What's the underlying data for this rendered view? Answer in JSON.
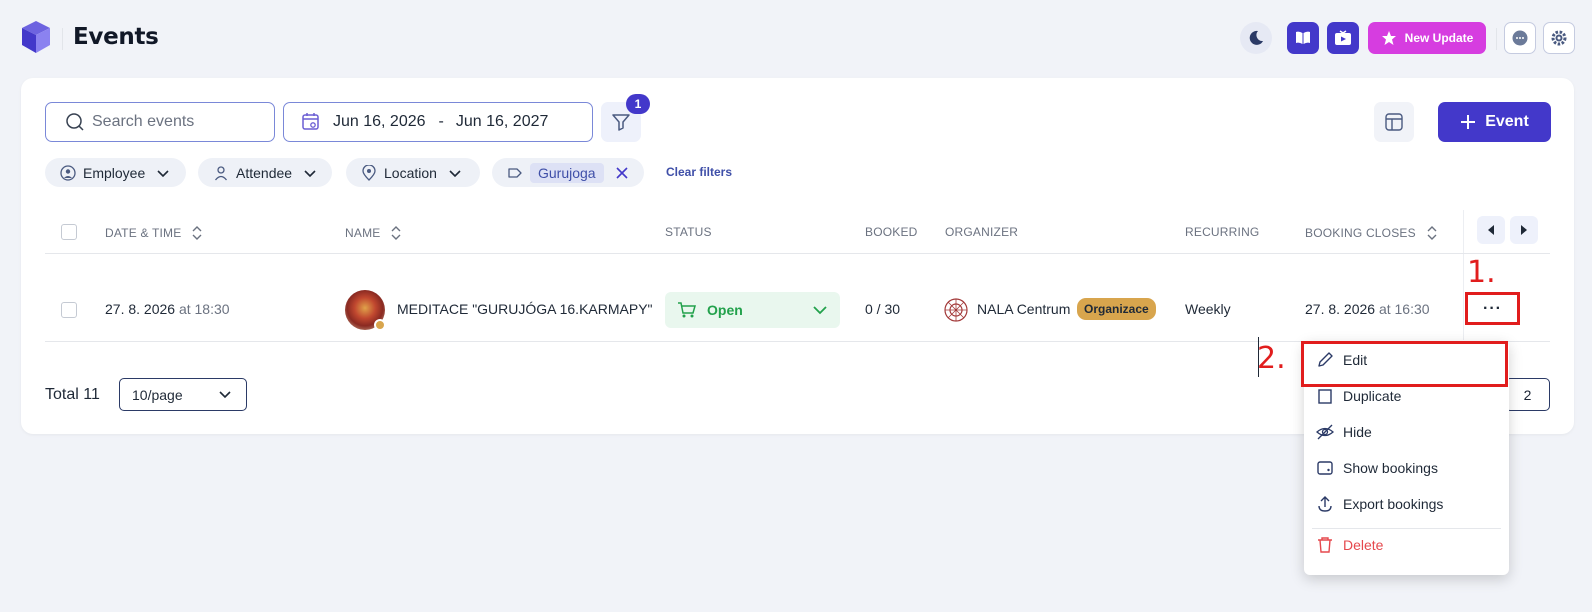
{
  "header": {
    "title": "Events",
    "new_update_label": "New Update"
  },
  "toolbar": {
    "search_placeholder": "Search events",
    "date_from": "Jun 16, 2026",
    "date_sep": "-",
    "date_to": "Jun 16, 2027",
    "filter_count": "1",
    "add_event_label": "Event"
  },
  "filters": {
    "employee": "Employee",
    "attendee": "Attendee",
    "location": "Location",
    "tag": "Gurujoga",
    "clear": "Clear filters"
  },
  "table": {
    "columns": {
      "datetime": "DATE & TIME",
      "name": "NAME",
      "status": "STATUS",
      "booked": "BOOKED",
      "organizer": "ORGANIZER",
      "recurring": "RECURRING",
      "booking_closes": "BOOKING CLOSES"
    },
    "rows": [
      {
        "date": "27. 8. 2026",
        "time": "at 18:30",
        "name": "MEDITACE \"GURUJÓGA 16.KARMAPY\"",
        "status": "Open",
        "booked": "0 / 30",
        "organizer": "NALA Centrum",
        "organizer_badge": "Organizace",
        "recurring": "Weekly",
        "close_date": "27. 8. 2026",
        "close_time": "at 16:30",
        "actions": "···"
      }
    ]
  },
  "footer": {
    "total": "Total 11",
    "per_page": "10/page",
    "page": "2"
  },
  "menu": {
    "edit": "Edit",
    "duplicate": "Duplicate",
    "hide": "Hide",
    "show_bookings": "Show bookings",
    "export_bookings": "Export bookings",
    "delete": "Delete"
  },
  "annotations": {
    "step1": "1.",
    "step2": "2."
  },
  "colors": {
    "primary": "#4338ca",
    "magenta": "#d63de0",
    "open_green": "#22a14b",
    "delete_red": "#e5484d",
    "annotation_red": "#e11d1d"
  }
}
